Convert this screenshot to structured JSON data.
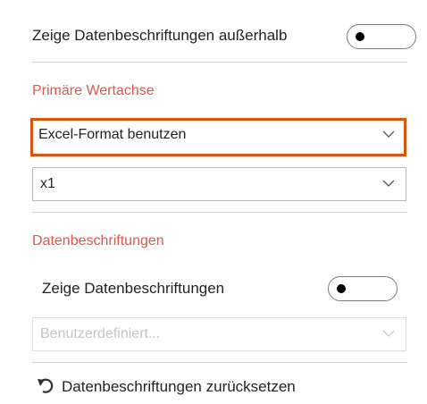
{
  "top_toggle": {
    "label": "Zeige Datenbeschriftungen außerhalb",
    "state": "off"
  },
  "primary_axis": {
    "title": "Primäre Wertachse",
    "format_dropdown": {
      "value": "Excel-Format benutzen"
    },
    "unit_dropdown": {
      "value": "x1"
    }
  },
  "data_labels": {
    "title": "Datenbeschriftungen",
    "toggle": {
      "label": "Zeige Datenbeschriftungen",
      "state": "off"
    },
    "custom_dropdown": {
      "value": "Benutzerdefiniert..."
    }
  },
  "reset": {
    "label": "Datenbeschriftungen zurücksetzen",
    "icon": "undo-icon"
  },
  "colors": {
    "section_title": "#d9584a",
    "highlight_border": "#d9550d"
  }
}
